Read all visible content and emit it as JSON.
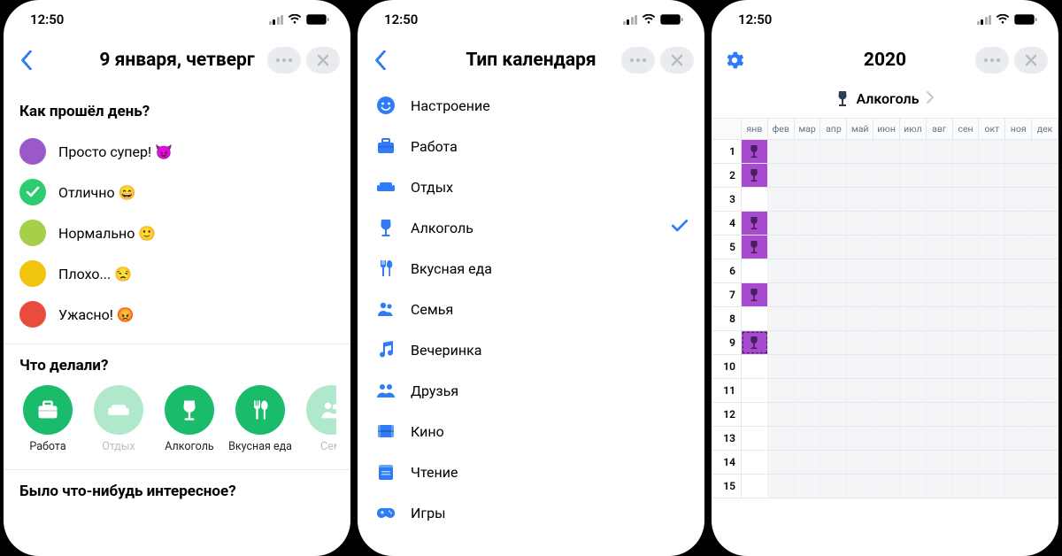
{
  "status": {
    "time": "12:50"
  },
  "screen1": {
    "title": "9 января, четверг",
    "q_mood": "Как прошёл день?",
    "moods": [
      {
        "label": "Просто супер! 😈",
        "color": "#9b59c8",
        "selected": false
      },
      {
        "label": "Отлично 😄",
        "color": "#2ecc71",
        "selected": true
      },
      {
        "label": "Нормально 🙂",
        "color": "#a6cf4a",
        "selected": false
      },
      {
        "label": "Плохо... 😒",
        "color": "#f1c40f",
        "selected": false
      },
      {
        "label": "Ужасно! 😡",
        "color": "#e74c3c",
        "selected": false
      }
    ],
    "q_activities": "Что делали?",
    "activities": [
      {
        "label": "Работа",
        "icon": "briefcase",
        "color": "#1abc6b",
        "dim": false
      },
      {
        "label": "Отдых",
        "icon": "couch",
        "color": "#1abc6b",
        "dim": true
      },
      {
        "label": "Алкоголь",
        "icon": "wine",
        "color": "#1abc6b",
        "dim": false
      },
      {
        "label": "Вкусная еда",
        "icon": "food",
        "color": "#1abc6b",
        "dim": false
      },
      {
        "label": "Сем",
        "icon": "people",
        "color": "#1abc6b",
        "dim": true
      }
    ],
    "q_notes": "Было что-нибудь интересное?"
  },
  "screen2": {
    "title": "Тип календаря",
    "categories": [
      {
        "label": "Настроение",
        "icon": "smiley",
        "checked": false
      },
      {
        "label": "Работа",
        "icon": "briefcase",
        "checked": false
      },
      {
        "label": "Отдых",
        "icon": "couch",
        "checked": false
      },
      {
        "label": "Алкоголь",
        "icon": "wine",
        "checked": true
      },
      {
        "label": "Вкусная еда",
        "icon": "food",
        "checked": false
      },
      {
        "label": "Семья",
        "icon": "people",
        "checked": false
      },
      {
        "label": "Вечеринка",
        "icon": "music",
        "checked": false
      },
      {
        "label": "Друзья",
        "icon": "friends",
        "checked": false
      },
      {
        "label": "Кино",
        "icon": "film",
        "checked": false
      },
      {
        "label": "Чтение",
        "icon": "book",
        "checked": false
      },
      {
        "label": "Игры",
        "icon": "gamepad",
        "checked": false
      }
    ]
  },
  "screen3": {
    "title": "2020",
    "filter_label": "Алкоголь",
    "months": [
      "янв",
      "фев",
      "мар",
      "апр",
      "май",
      "июн",
      "июл",
      "авг",
      "сен",
      "окт",
      "ноя",
      "дек"
    ],
    "days": [
      1,
      2,
      3,
      4,
      5,
      6,
      7,
      8,
      9,
      10,
      11,
      12,
      13,
      14,
      15
    ],
    "marks_jan": [
      1,
      2,
      4,
      5,
      7,
      9
    ],
    "selected_day": 9
  }
}
